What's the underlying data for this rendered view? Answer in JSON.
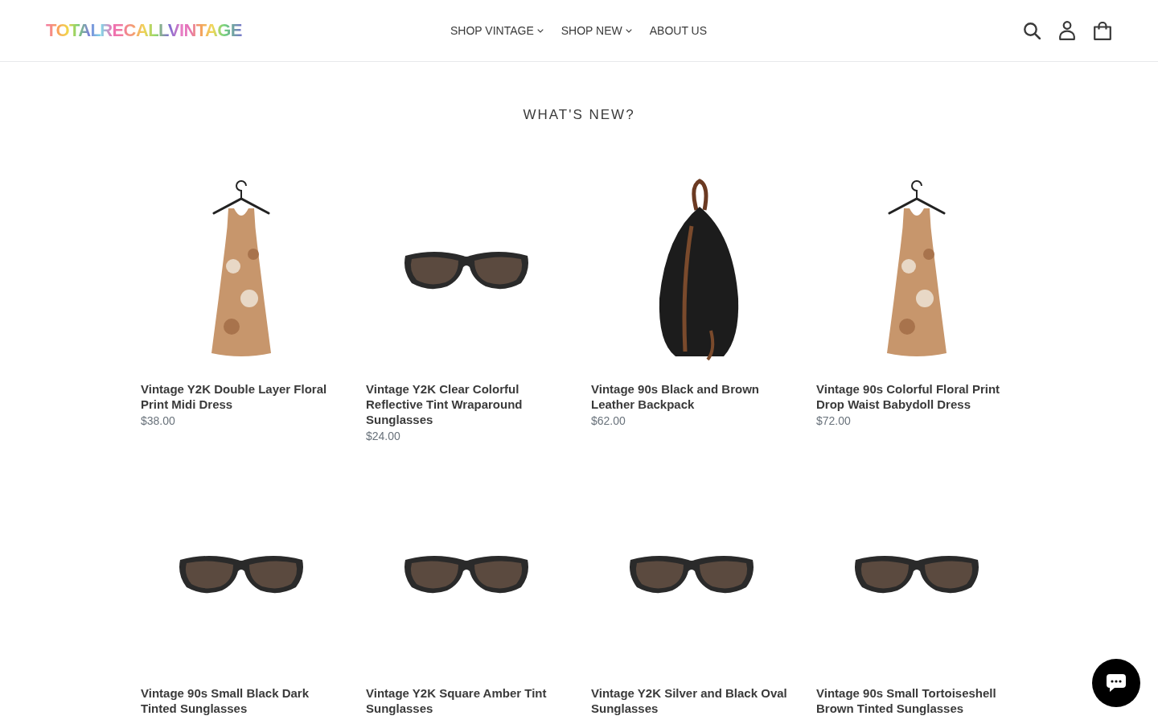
{
  "header": {
    "logo": "TOTAL RECALL VINTAGE",
    "nav": [
      {
        "label": "SHOP VINTAGE",
        "dropdown": true
      },
      {
        "label": "SHOP NEW",
        "dropdown": true
      },
      {
        "label": "ABOUT US",
        "dropdown": false
      }
    ]
  },
  "section": {
    "title": "WHAT'S NEW?",
    "products": [
      {
        "kind": "dress",
        "title": "Vintage Y2K Double Layer Floral Print Midi Dress",
        "price": "$38.00"
      },
      {
        "kind": "sunglasses",
        "title": "Vintage Y2K Clear Colorful Reflective Tint Wraparound Sunglasses",
        "price": "$24.00"
      },
      {
        "kind": "backpack",
        "title": "Vintage 90s Black and Brown Leather Backpack",
        "price": "$62.00"
      },
      {
        "kind": "dress",
        "title": "Vintage 90s Colorful Floral Print Drop Waist Babydoll Dress",
        "price": "$72.00"
      },
      {
        "kind": "sunglasses",
        "title": "Vintage 90s Small Black Dark Tinted Sunglasses"
      },
      {
        "kind": "sunglasses",
        "title": "Vintage Y2K Square Amber Tint Sunglasses"
      },
      {
        "kind": "sunglasses",
        "title": "Vintage Y2K Silver and Black Oval Sunglasses"
      },
      {
        "kind": "sunglasses",
        "title": "Vintage 90s Small Tortoiseshell Brown Tinted Sunglasses"
      }
    ]
  }
}
